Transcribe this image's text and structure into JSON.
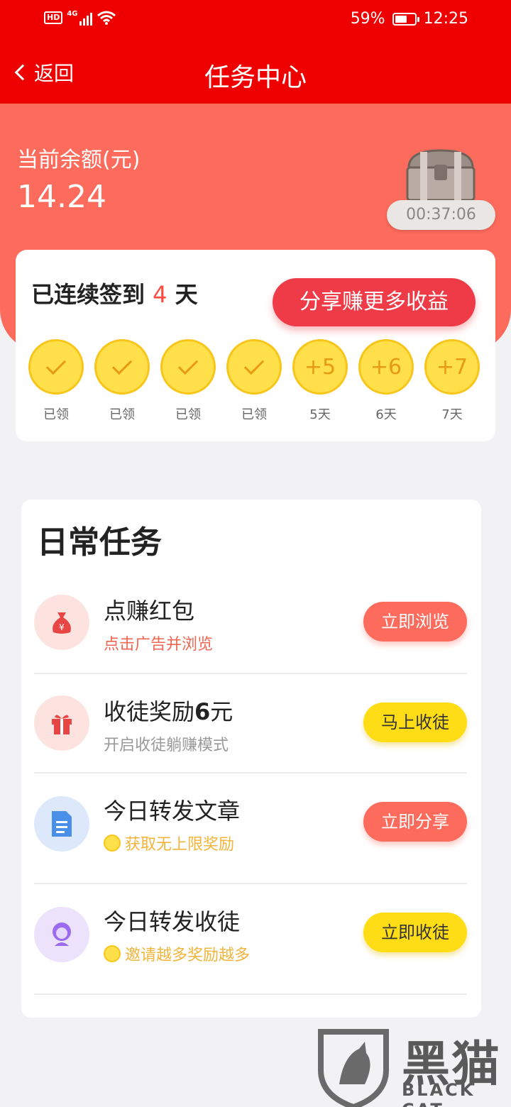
{
  "status_bar": {
    "hd": "HD",
    "network": "4G",
    "battery_pct": "59%",
    "time": "12:25"
  },
  "nav": {
    "back_label": "返回",
    "title": "任务中心"
  },
  "balance": {
    "label": "当前余额(元)",
    "value": "14.24"
  },
  "chest": {
    "timer": "00:37:06"
  },
  "signin": {
    "prefix": "已连续签到",
    "days": "4",
    "suffix": "天",
    "share_button": "分享赚更多收益",
    "coins": [
      {
        "state": "claimed",
        "amount": "",
        "label": "已领"
      },
      {
        "state": "claimed",
        "amount": "",
        "label": "已领"
      },
      {
        "state": "claimed",
        "amount": "",
        "label": "已领"
      },
      {
        "state": "claimed",
        "amount": "",
        "label": "已领"
      },
      {
        "state": "pending",
        "amount": "+5",
        "label": "5天"
      },
      {
        "state": "pending",
        "amount": "+6",
        "label": "6天"
      },
      {
        "state": "pending",
        "amount": "+7",
        "label": "7天"
      }
    ]
  },
  "daily": {
    "title": "日常任务",
    "tasks": [
      {
        "icon": "money-bag-icon",
        "title": "点赚红包",
        "title_bold": "",
        "title_after": "",
        "subtitle": "点击广告并浏览",
        "subtitle_color": "#f06552",
        "has_coin": false,
        "button": "立即浏览",
        "button_style": "red",
        "icon_bg": "#fde3df"
      },
      {
        "icon": "gift-icon",
        "title": "收徒奖励",
        "title_bold": "6",
        "title_after": "元",
        "subtitle": "开启收徒躺赚模式",
        "subtitle_color": "#999999",
        "has_coin": false,
        "button": "马上收徒",
        "button_style": "yellow",
        "icon_bg": "#fde3df"
      },
      {
        "icon": "document-icon",
        "title": "今日转发文章",
        "title_bold": "",
        "title_after": "",
        "subtitle": "获取无上限奖励",
        "subtitle_color": "#f2b43a",
        "has_coin": true,
        "button": "立即分享",
        "button_style": "red",
        "icon_bg": "#dde9fb"
      },
      {
        "icon": "user-avatar-icon",
        "title": "今日转发收徒",
        "title_bold": "",
        "title_after": "",
        "subtitle": "邀请越多奖励越多",
        "subtitle_color": "#f2b43a",
        "has_coin": true,
        "button": "立即收徒",
        "button_style": "yellow",
        "icon_bg": "#ece2fb"
      }
    ]
  },
  "watermark": {
    "brand_cn": "黑猫",
    "brand_en": "BLACK CAT"
  }
}
